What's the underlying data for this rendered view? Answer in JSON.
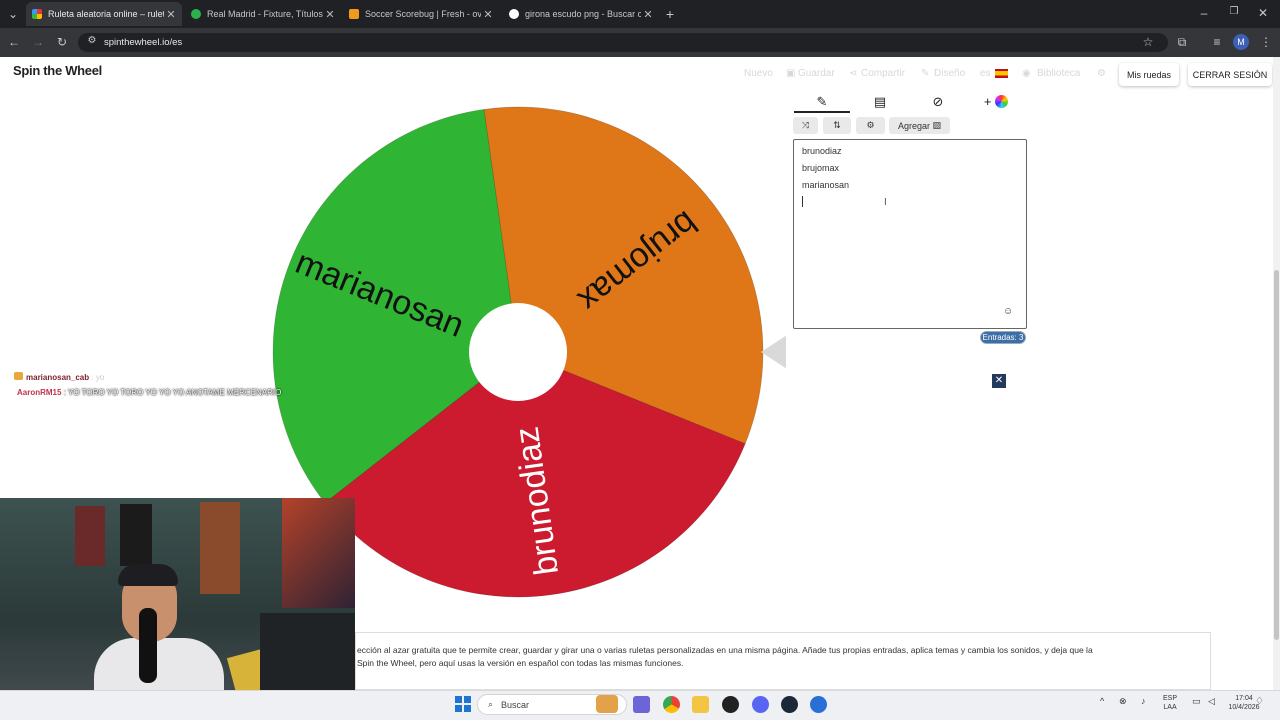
{
  "browser": {
    "tabs": [
      {
        "title": "Ruleta aleatoria online – ruleta",
        "active": true
      },
      {
        "title": "Real Madrid - Fixture, Títulos y",
        "active": false
      },
      {
        "title": "Soccer Scorebug | Fresh - overl",
        "active": false
      },
      {
        "title": "girona escudo png - Buscar con",
        "active": false
      }
    ],
    "url": "spinthewheel.io/es",
    "profile_initial": "M"
  },
  "header": {
    "logo": "Spin the Wheel",
    "nav": {
      "nuevo": "Nuevo",
      "guardar": "Guardar",
      "compartir": "Compartir",
      "diseno": "Diseño",
      "lang": "es",
      "biblioteca": "Biblioteca"
    },
    "mis_ruedas": "Mis ruedas",
    "cerrar_sesion": "CERRAR SESIÓN"
  },
  "wheel": {
    "segments": [
      {
        "label": "brujomax",
        "color": "#df7617"
      },
      {
        "label": "brunodiaz",
        "color": "#cc1a2f"
      },
      {
        "label": "marianosan",
        "color": "#2fb533"
      }
    ],
    "pointer_color": "#d9d9d9"
  },
  "editor": {
    "add_button": "Agregar",
    "entries": [
      "brunodiaz",
      "brujomax",
      "marianosan"
    ],
    "count_label": "Entradas: 3"
  },
  "chat": [
    {
      "user": "marianosan_cab",
      "text": ": yo",
      "color": "#7a1f2a"
    },
    {
      "user": "AaronRM15",
      "text": ": YO TORO YO TORO YO YO YO ANOTAME MERCENARIO",
      "color": "#c0334a"
    }
  ],
  "description": {
    "line1": "ección al azar gratuita que te permite crear, guardar y girar una o varias ruletas personalizadas en una misma página. Añade tus propias entradas, aplica temas y cambia los sonidos, y deja que la",
    "line2": "Spin the Wheel, pero aquí usas la versión en español con todas las mismas funciones."
  },
  "taskbar": {
    "search_placeholder": "Buscar",
    "lang_line1": "ESP",
    "lang_line2": "LAA",
    "time": "17:04",
    "date": "10/4/2026"
  }
}
